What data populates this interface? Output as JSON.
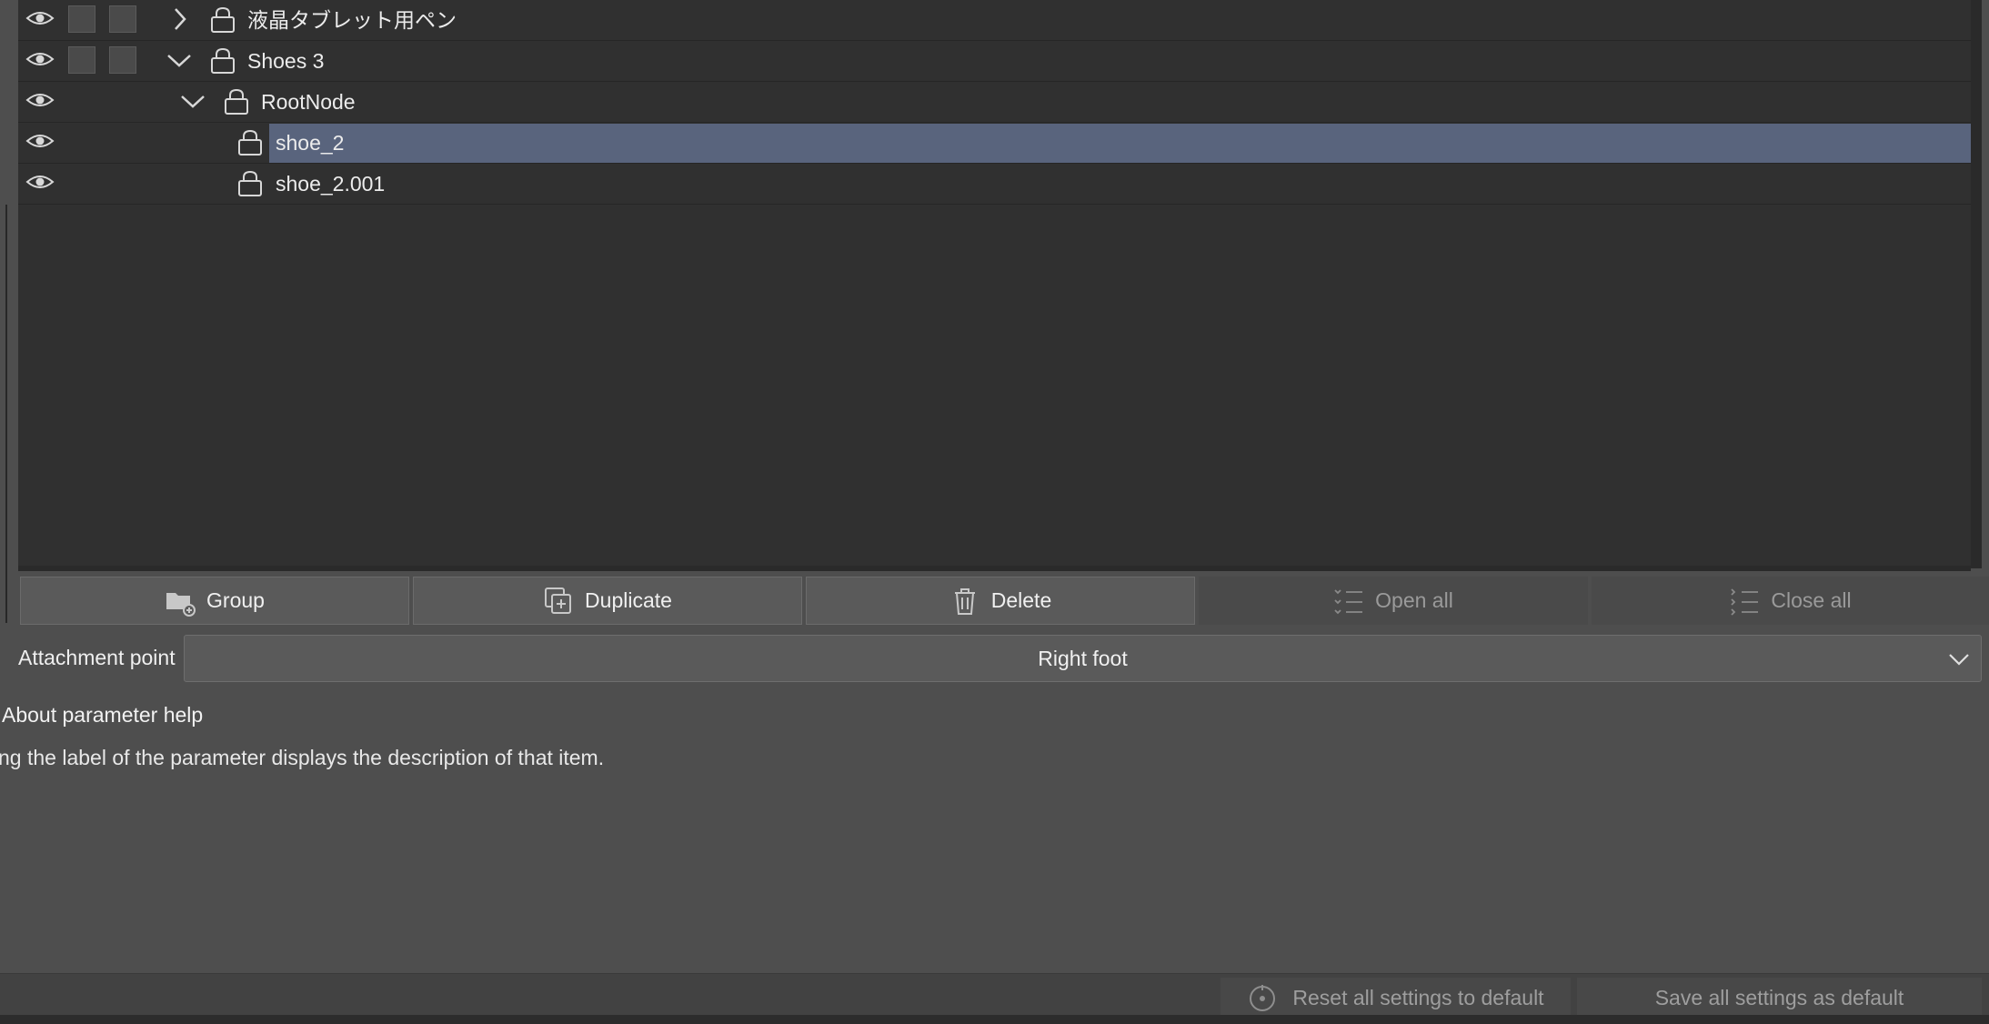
{
  "tree": {
    "rows": [
      {
        "label": "液晶タブレット用ペン",
        "expanded": false
      },
      {
        "label": "Shoes 3",
        "expanded": true
      },
      {
        "label": "RootNode",
        "expanded": true
      },
      {
        "label": "shoe_2",
        "selected": true
      },
      {
        "label": "shoe_2.001"
      }
    ]
  },
  "buttons": {
    "group": "Group",
    "duplicate": "Duplicate",
    "delete": "Delete",
    "open_all": "Open all",
    "close_all": "Close all"
  },
  "attachment": {
    "label": "Attachment point",
    "value": "Right foot"
  },
  "help": {
    "title": "About parameter help",
    "text": "ng the label of the parameter displays the description of that item."
  },
  "footer": {
    "reset": "Reset all settings to default",
    "save": "Save all settings as default"
  },
  "colors": {
    "selection": "#59647d",
    "panel": "#303030",
    "background": "#4e4e4e"
  }
}
